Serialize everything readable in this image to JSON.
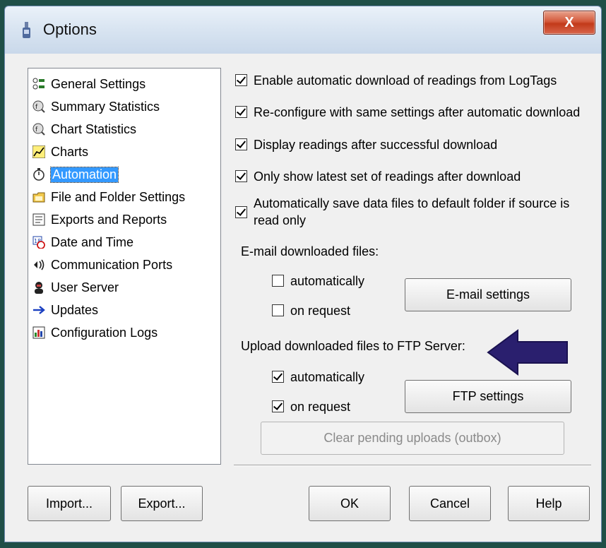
{
  "window": {
    "title": "Options",
    "close_label": "X"
  },
  "tree": {
    "items": [
      {
        "label": "General Settings",
        "icon": "settings-list-icon",
        "selected": false
      },
      {
        "label": "Summary Statistics",
        "icon": "statistics-magnifier-icon",
        "selected": false
      },
      {
        "label": "Chart Statistics",
        "icon": "statistics-magnifier-icon",
        "selected": false
      },
      {
        "label": "Charts",
        "icon": "line-chart-icon",
        "selected": false
      },
      {
        "label": "Automation",
        "icon": "stopwatch-icon",
        "selected": true
      },
      {
        "label": "File and Folder Settings",
        "icon": "folder-icon",
        "selected": false
      },
      {
        "label": "Exports and Reports",
        "icon": "report-icon",
        "selected": false
      },
      {
        "label": "Date and Time",
        "icon": "calendar-clock-icon",
        "selected": false
      },
      {
        "label": "Communication Ports",
        "icon": "port-icon",
        "selected": false
      },
      {
        "label": "User Server",
        "icon": "user-icon",
        "selected": false
      },
      {
        "label": "Updates",
        "icon": "arrow-right-icon",
        "selected": false
      },
      {
        "label": "Configuration Logs",
        "icon": "log-icon",
        "selected": false
      }
    ]
  },
  "automation": {
    "enable_auto_download": {
      "label": "Enable automatic download of readings from LogTags",
      "checked": true
    },
    "reconfigure": {
      "label": "Re-configure with same settings after automatic download",
      "checked": true
    },
    "display_readings": {
      "label": "Display readings after successful download",
      "checked": true
    },
    "only_latest": {
      "label": "Only show latest set of readings after download",
      "checked": true
    },
    "auto_save": {
      "label": "Automatically save data files to default folder if source is read only",
      "checked": true
    },
    "email_heading": "E-mail downloaded files:",
    "email_auto": {
      "label": "automatically",
      "checked": false
    },
    "email_request": {
      "label": "on request",
      "checked": false
    },
    "email_settings_label": "E-mail settings",
    "ftp_heading": "Upload downloaded files to FTP Server:",
    "ftp_auto": {
      "label": "automatically",
      "checked": true
    },
    "ftp_request": {
      "label": "on request",
      "checked": true
    },
    "ftp_settings_label": "FTP settings",
    "clear_pending_label": "Clear pending uploads (outbox)"
  },
  "footer": {
    "import_label": "Import...",
    "export_label": "Export...",
    "ok_label": "OK",
    "cancel_label": "Cancel",
    "help_label": "Help"
  },
  "colors": {
    "selection": "#3399ff",
    "arrow": "#2a1f6e",
    "frame": "#1f4f47"
  }
}
